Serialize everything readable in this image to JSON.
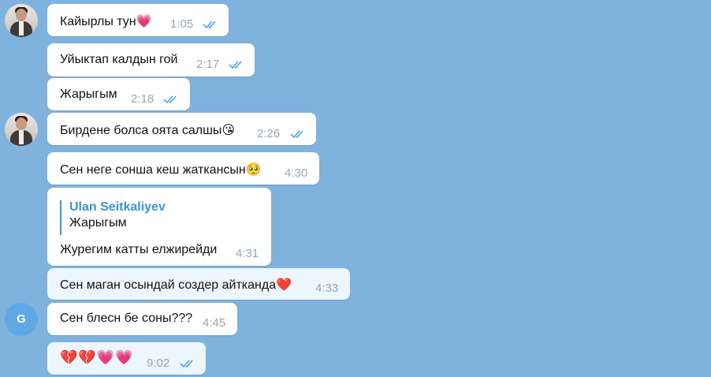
{
  "colors": {
    "background": "#7fb3de",
    "bubble": "#ffffff",
    "bubble_light": "#eef6fd",
    "time": "#9aa5b1",
    "check": "#4fa3e3",
    "reply_accent": "#3b93d6",
    "heart_red": "#e0263b",
    "heart_pink": "#ef5aa8"
  },
  "messages": [
    {
      "text": "Кайырлы тун",
      "emoji": "💗",
      "time": "1:05",
      "read": true
    },
    {
      "text": "Уйыктап калдын гой",
      "time": "2:17",
      "read": true
    },
    {
      "text": "Жарыгым",
      "time": "2:18",
      "read": true
    },
    {
      "text": "Бирдене болса оята салшы",
      "emoji": "😘",
      "time": "2:26",
      "read": true
    },
    {
      "text": "Сен неге сонша кеш жаткансын",
      "emoji": "🥺",
      "time": "4:30"
    },
    {
      "reply_name": "Ulan Seitkaliyev",
      "reply_text": "Жарыгым",
      "text": "Журегим катты елжирейди",
      "time": "4:31"
    },
    {
      "text": "Сен маган осындай создер айтканда",
      "emoji": "❤️",
      "time": "4:33"
    },
    {
      "text": "Сен блесн бе соны???",
      "time": "4:45"
    },
    {
      "emoji": "💔💔💗💗",
      "time": "9:02",
      "read": true
    }
  ],
  "avatars": {
    "contact_initial": "G"
  }
}
